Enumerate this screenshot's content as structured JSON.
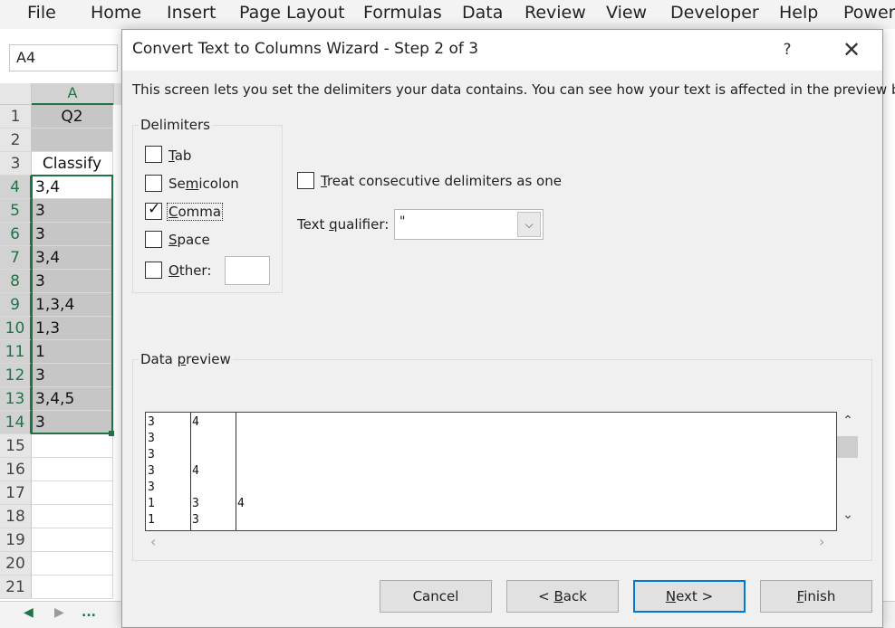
{
  "ribbon": {
    "tabs": [
      "File",
      "Home",
      "Insert",
      "Page Layout",
      "Formulas",
      "Data",
      "Review",
      "View",
      "Developer",
      "Help",
      "Power"
    ]
  },
  "name_box": {
    "value": "A4"
  },
  "sheet": {
    "column_label": "A",
    "rows": [
      {
        "num": "1",
        "value": "Q2"
      },
      {
        "num": "2",
        "value": ""
      },
      {
        "num": "3",
        "value": "Classify"
      },
      {
        "num": "4",
        "value": "3,4"
      },
      {
        "num": "5",
        "value": "3"
      },
      {
        "num": "6",
        "value": "3"
      },
      {
        "num": "7",
        "value": "3,4"
      },
      {
        "num": "8",
        "value": "3"
      },
      {
        "num": "9",
        "value": "1,3,4"
      },
      {
        "num": "10",
        "value": "1,3"
      },
      {
        "num": "11",
        "value": "1"
      },
      {
        "num": "12",
        "value": "3"
      },
      {
        "num": "13",
        "value": "3,4,5"
      },
      {
        "num": "14",
        "value": "3"
      },
      {
        "num": "15",
        "value": ""
      },
      {
        "num": "16",
        "value": ""
      },
      {
        "num": "17",
        "value": ""
      },
      {
        "num": "18",
        "value": ""
      },
      {
        "num": "19",
        "value": ""
      },
      {
        "num": "20",
        "value": ""
      },
      {
        "num": "21",
        "value": ""
      }
    ],
    "nav_prev": "◀",
    "nav_next": "▶",
    "nav_more": "..."
  },
  "dialog": {
    "title": "Convert Text to Columns Wizard - Step 2 of 3",
    "help": "?",
    "close": "✕",
    "description": "This screen lets you set the delimiters your data contains.  You can see how your text is affected in the preview below.",
    "delimiters_label": "Delimiters",
    "delimiters": {
      "tab": {
        "pre": "",
        "key": "T",
        "post": "ab",
        "checked": false
      },
      "semicolon": {
        "pre": "Se",
        "key": "m",
        "post": "icolon",
        "checked": false
      },
      "comma": {
        "pre": "",
        "key": "C",
        "post": "omma",
        "checked": true
      },
      "space": {
        "pre": "",
        "key": "S",
        "post": "pace",
        "checked": false
      },
      "other": {
        "pre": "",
        "key": "O",
        "post": "ther:",
        "checked": false,
        "value": ""
      }
    },
    "consecutive": {
      "pre": "",
      "key": "T",
      "post": "reat consecutive delimiters as one",
      "checked": false
    },
    "qualifier": {
      "pre": "Text ",
      "key": "q",
      "post": "ualifier:",
      "value": "\""
    },
    "preview_label_pre": "Data ",
    "preview_label_key": "p",
    "preview_label_post": "review",
    "preview_rows": [
      [
        "3",
        "4",
        ""
      ],
      [
        "3",
        "",
        ""
      ],
      [
        "3",
        "",
        ""
      ],
      [
        "3",
        "4",
        ""
      ],
      [
        "3",
        "",
        ""
      ],
      [
        "1",
        "3",
        "4"
      ],
      [
        "1",
        "3",
        ""
      ]
    ],
    "scroll_up": "⌃",
    "scroll_down": "⌄",
    "scroll_left": "‹",
    "scroll_right": "›",
    "buttons": {
      "cancel": "Cancel",
      "back_pre": "< ",
      "back_key": "B",
      "back_post": "ack",
      "next_pre": "",
      "next_key": "N",
      "next_post": "ext >",
      "finish_pre": "",
      "finish_key": "F",
      "finish_post": "inish"
    }
  }
}
